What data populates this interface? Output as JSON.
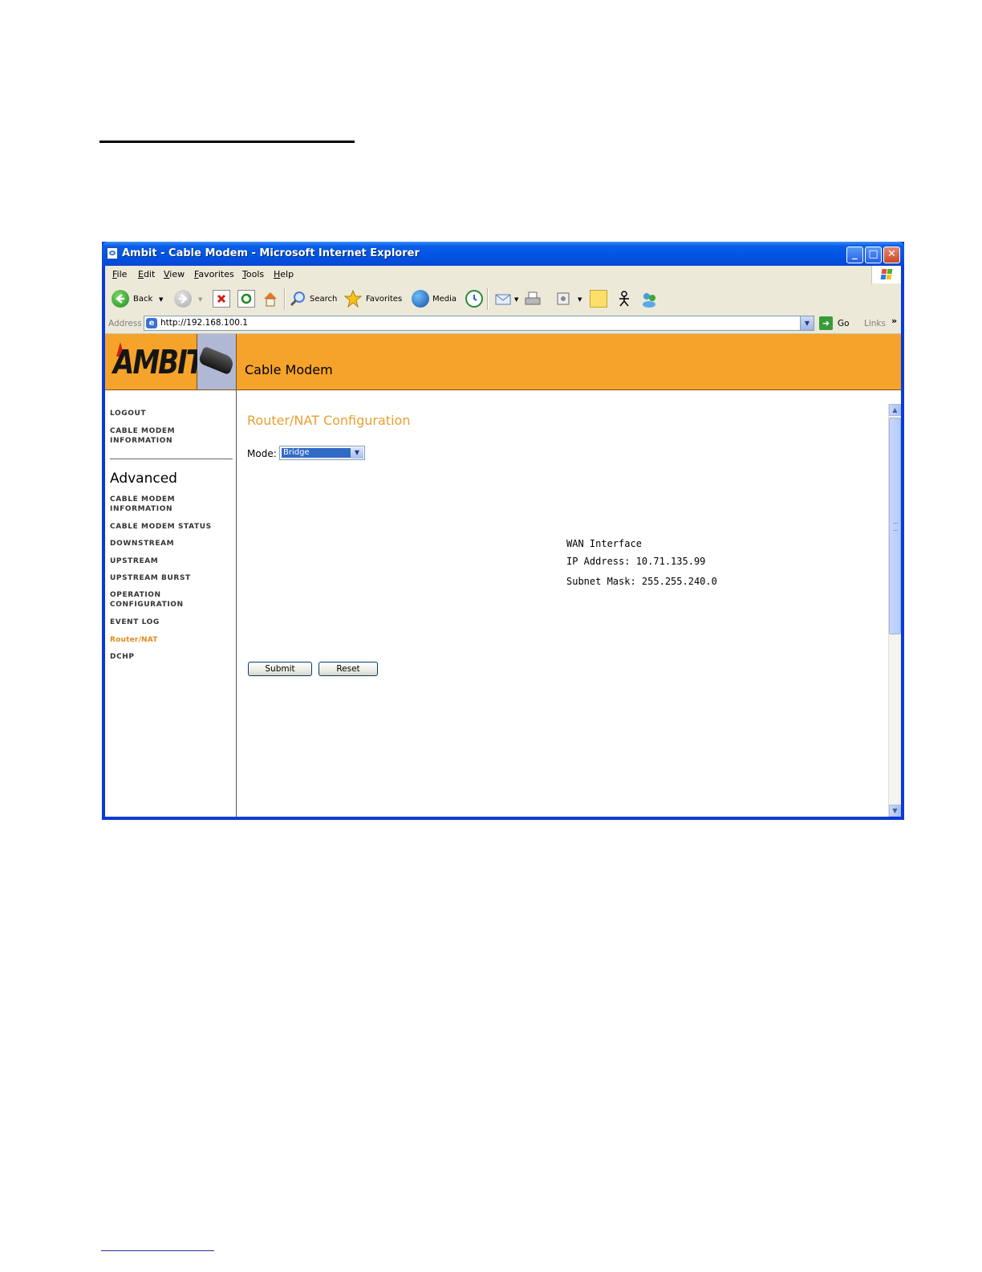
{
  "window": {
    "title": "Ambit - Cable Modem - Microsoft Internet Explorer",
    "minimize_label": "_",
    "maximize_label": "□",
    "close_label": "✕"
  },
  "menu": [
    "File",
    "Edit",
    "View",
    "Favorites",
    "Tools",
    "Help"
  ],
  "toolbar": {
    "back_label": "Back",
    "search_label": "Search",
    "favorites_label": "Favorites",
    "media_label": "Media",
    "icons": [
      "back-icon",
      "forward-icon",
      "stop-icon",
      "refresh-icon",
      "home-icon",
      "search-icon",
      "favorites-icon",
      "media-icon",
      "history-icon",
      "mail-icon",
      "print-icon",
      "edit-icon",
      "discuss-icon",
      "messenger-icon",
      "contacts-icon"
    ]
  },
  "address": {
    "label": "Address",
    "url": "http://192.168.100.1",
    "go_label": "Go",
    "links_label": "Links",
    "more_label": "»"
  },
  "page": {
    "logo_text": "AMBIT",
    "banner_title": "Cable Modem",
    "nav_top": [
      "LOGOUT",
      "CABLE MODEM INFORMATION"
    ],
    "nav_heading": "Advanced",
    "nav_advanced": [
      "CABLE MODEM INFORMATION",
      "CABLE MODEM STATUS",
      "DOWNSTREAM",
      "UPSTREAM",
      "UPSTREAM BURST",
      "OPERATION CONFIGURATION",
      "EVENT LOG",
      "Router/NAT",
      "DCHP"
    ],
    "active_nav": "Router/NAT",
    "title": "Router/NAT Configuration",
    "mode_label": "Mode:",
    "mode_value": "Bridge",
    "wan_heading": "WAN Interface",
    "ip_address": "IP Address: 10.71.135.99",
    "subnet_mask": "Subnet Mask: 255.255.240.0",
    "submit_label": "Submit",
    "reset_label": "Reset"
  },
  "colors": {
    "banner": "#f5a32a",
    "title_accent": "#e8a030",
    "titlebar": "#0054e3"
  }
}
